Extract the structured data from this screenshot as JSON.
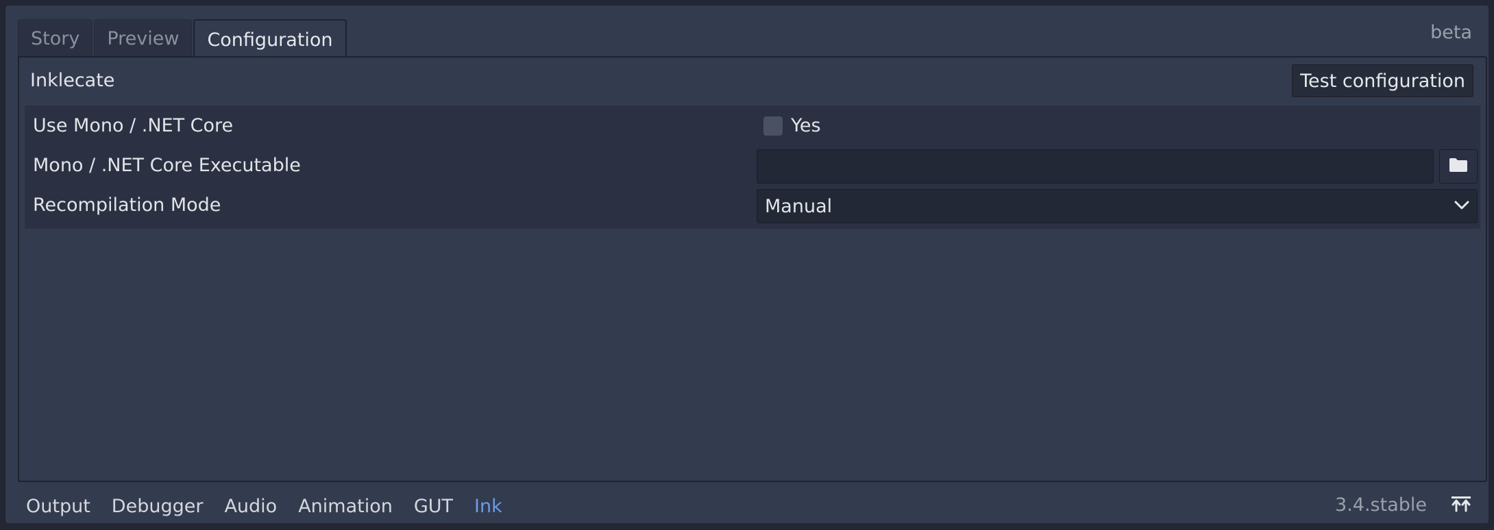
{
  "tabs": [
    {
      "label": "Story"
    },
    {
      "label": "Preview"
    },
    {
      "label": "Configuration"
    }
  ],
  "badge": "beta",
  "section": {
    "title": "Inklecate",
    "test_button": "Test configuration"
  },
  "settings": {
    "use_mono": {
      "label": "Use Mono / .NET Core",
      "checkbox_label": "Yes",
      "checked": false
    },
    "executable": {
      "label": "Mono / .NET Core Executable",
      "value": ""
    },
    "recompilation": {
      "label": "Recompilation Mode",
      "value": "Manual"
    }
  },
  "bottom_tabs": [
    {
      "label": "Output"
    },
    {
      "label": "Debugger"
    },
    {
      "label": "Audio"
    },
    {
      "label": "Animation"
    },
    {
      "label": "GUT"
    },
    {
      "label": "Ink"
    }
  ],
  "version": "3.4.stable",
  "colors": {
    "accent": "#6c9de3",
    "panel": "#333b4f",
    "background": "#222733"
  },
  "icons": {
    "browse": "folder-icon",
    "dropdown": "chevron-down-icon",
    "expand": "expand-panel-icon"
  }
}
